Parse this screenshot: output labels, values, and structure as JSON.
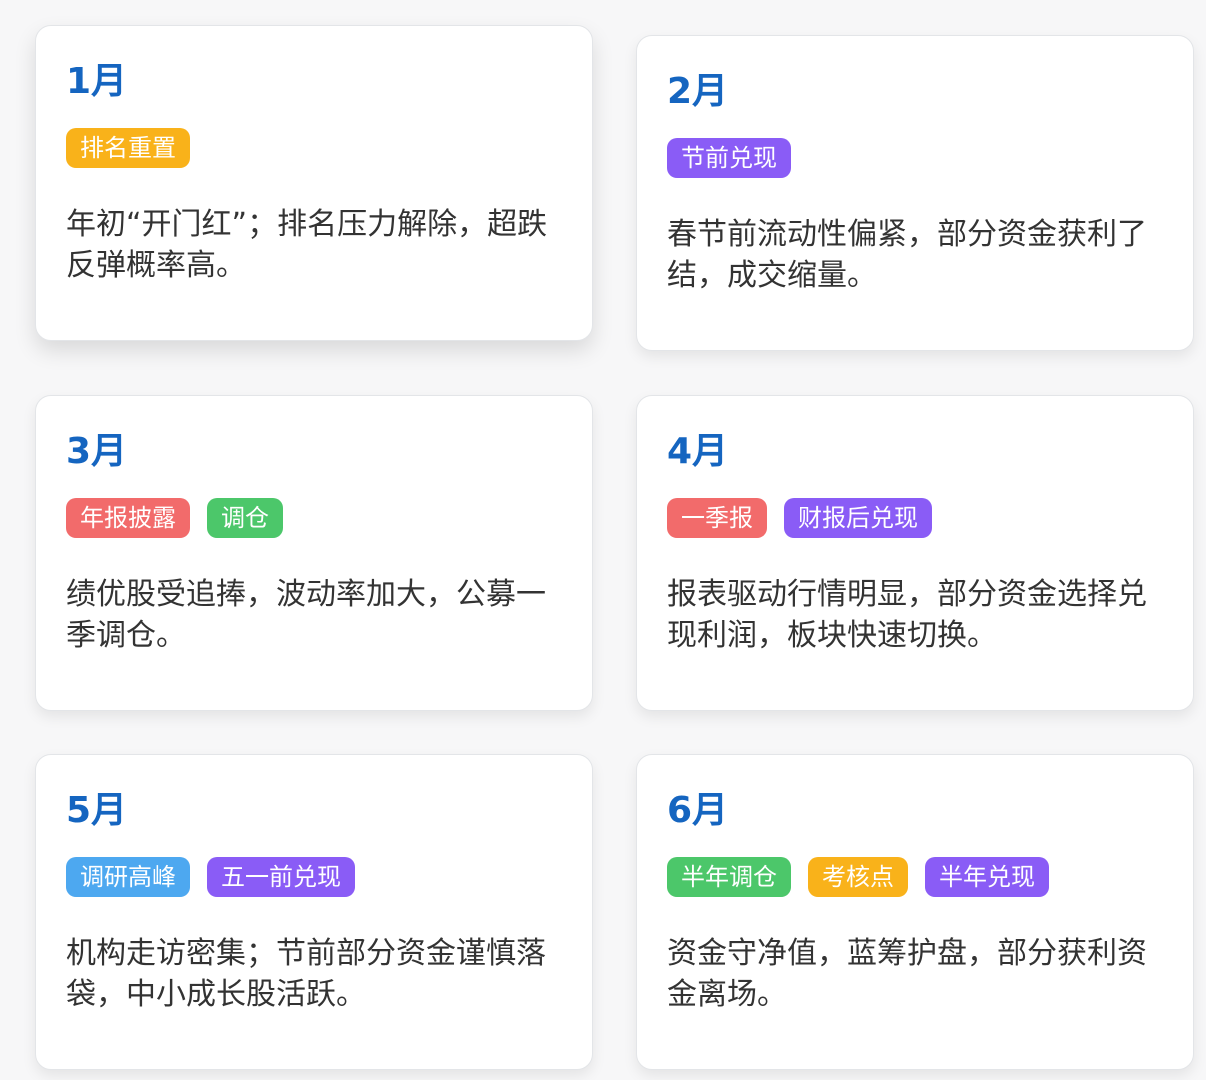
{
  "colors": {
    "month": "#1565c0",
    "orange": "#f9b21a",
    "purple": "#8a5cf6",
    "red": "#f26b6b",
    "green": "#4cc76a",
    "blue": "#4da8f0"
  },
  "cards": [
    {
      "month": "1月",
      "tags": [
        {
          "label": "排名重置",
          "color": "#f9b21a"
        }
      ],
      "desc": "年初“开门红”；排名压力解除，超跌反弹概率高。"
    },
    {
      "month": "2月",
      "tags": [
        {
          "label": "节前兑现",
          "color": "#8a5cf6"
        }
      ],
      "desc": "春节前流动性偏紧，部分资金获利了结，成交缩量。"
    },
    {
      "month": "3月",
      "tags": [
        {
          "label": "年报披露",
          "color": "#f26b6b"
        },
        {
          "label": "调仓",
          "color": "#4cc76a"
        }
      ],
      "desc": "绩优股受追捧，波动率加大，公募一季调仓。"
    },
    {
      "month": "4月",
      "tags": [
        {
          "label": "一季报",
          "color": "#f26b6b"
        },
        {
          "label": "财报后兑现",
          "color": "#8a5cf6"
        }
      ],
      "desc": "报表驱动行情明显，部分资金选择兑现利润，板块快速切换。"
    },
    {
      "month": "5月",
      "tags": [
        {
          "label": "调研高峰",
          "color": "#4da8f0"
        },
        {
          "label": "五一前兑现",
          "color": "#8a5cf6"
        }
      ],
      "desc": "机构走访密集；节前部分资金谨慎落袋，中小成长股活跃。"
    },
    {
      "month": "6月",
      "tags": [
        {
          "label": "半年调仓",
          "color": "#4cc76a"
        },
        {
          "label": "考核点",
          "color": "#f9b21a"
        },
        {
          "label": "半年兑现",
          "color": "#8a5cf6"
        }
      ],
      "desc": "资金守净值，蓝筹护盘，部分获利资金离场。"
    }
  ]
}
